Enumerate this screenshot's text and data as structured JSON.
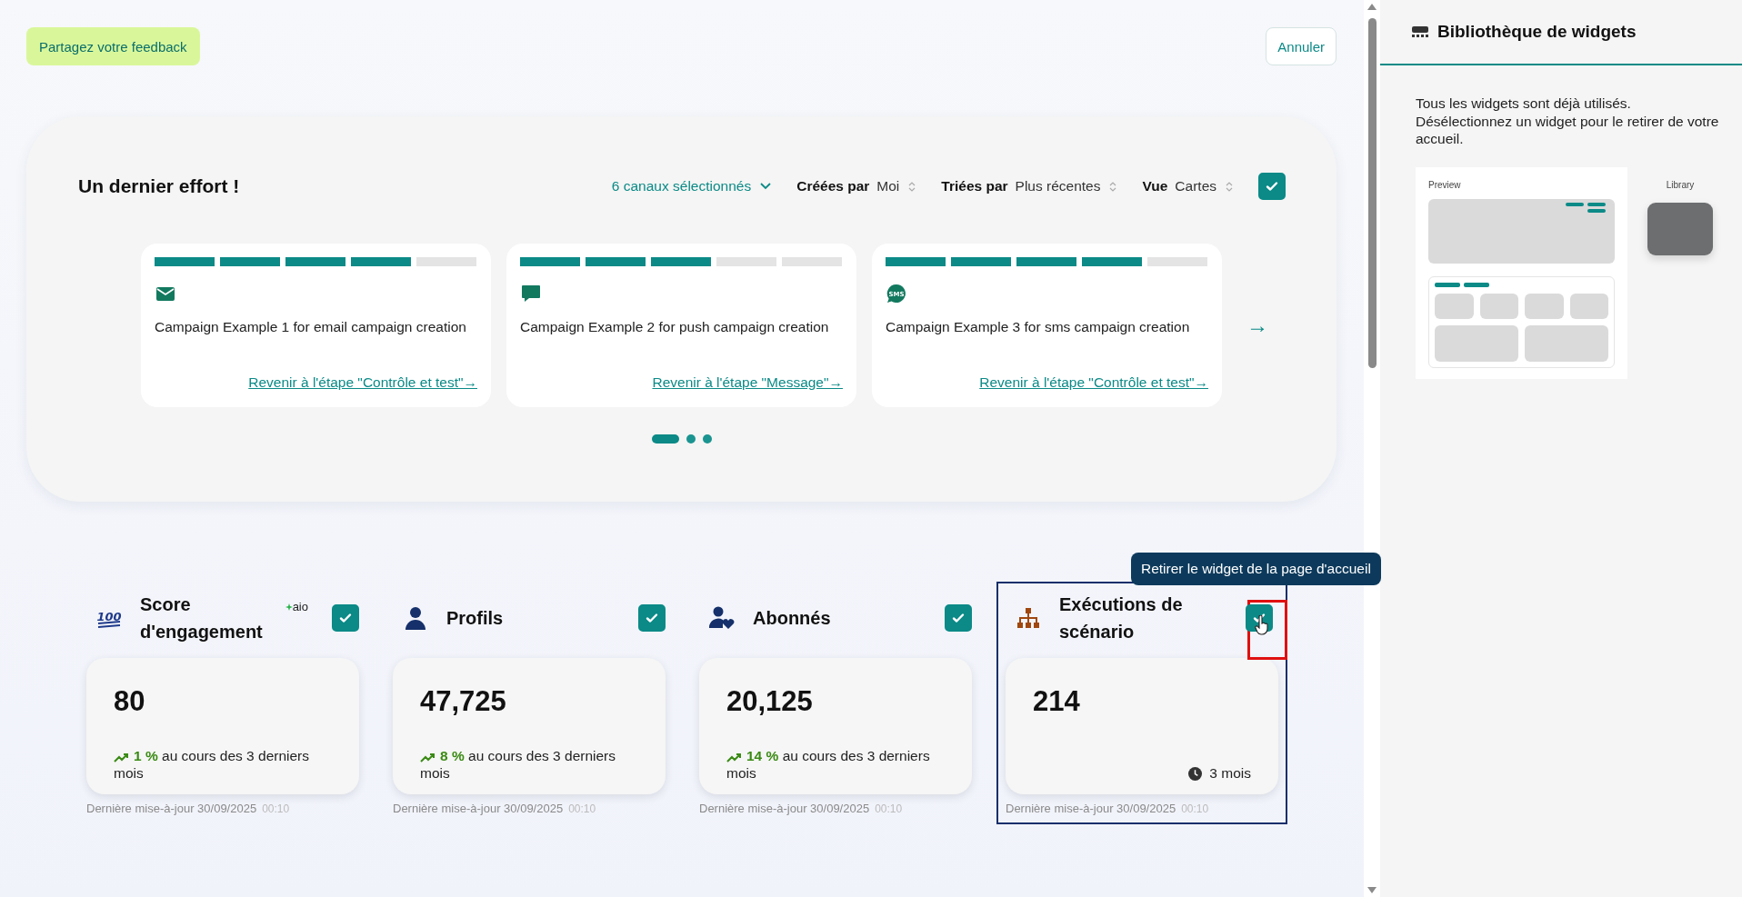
{
  "feedback_button": "Partagez votre feedback",
  "cancel_button": "Annuler",
  "carousel": {
    "title": "Un dernier effort !",
    "filters": [
      {
        "kind": "dropdown",
        "value": "6 canaux sélectionnés"
      },
      {
        "kind": "sort",
        "label": "Créées par",
        "value": "Moi"
      },
      {
        "kind": "sort",
        "label": "Triées par",
        "value": "Plus récentes"
      },
      {
        "kind": "sort",
        "label": "Vue",
        "value": "Cartes"
      }
    ],
    "checked": true,
    "campaigns": [
      {
        "kind": "email",
        "level": 0.8,
        "name": "Campaign Example 1 for email campaign creation",
        "link": "Revenir à l'étape \"Contrôle et test\"→"
      },
      {
        "kind": "push",
        "level": 0.6,
        "name": "Campaign Example 2 for push campaign creation",
        "link": "Revenir à l'étape \"Message\"→"
      },
      {
        "kind": "sms",
        "icon_text": "SMS",
        "level": 0.8,
        "name": "Campaign Example 3 for sms campaign creation",
        "link": "Revenir à l'étape \"Contrôle et test\"→"
      }
    ],
    "next_button": "→",
    "pages": [
      {
        "selected": true
      },
      {
        "selected": false
      },
      {
        "selected": false
      }
    ]
  },
  "widgets": [
    {
      "kind": "score",
      "icon_text": "100",
      "title": "Score d'engagement",
      "badge": "aio",
      "checked": true,
      "highlighted": false,
      "value": "80",
      "trend": "**1 %** au cours des 3 derniers mois",
      "updated": "Dernière mise-à-jour 30/09/2025",
      "time": "00:10"
    },
    {
      "kind": "profiles",
      "title": "Profils",
      "checked": true,
      "highlighted": false,
      "value": "47,725",
      "trend": "**8 %** au cours des 3 derniers mois",
      "updated": "Dernière mise-à-jour 30/09/2025",
      "time": "00:10"
    },
    {
      "kind": "subscribers",
      "title": "Abonnés",
      "checked": true,
      "highlighted": false,
      "value": "20,125",
      "trend": "**14 %** au cours des 3 derniers mois",
      "updated": "Dernière mise-à-jour 30/09/2025",
      "time": "00:10"
    },
    {
      "kind": "scenario",
      "title": "Exécutions de scénario",
      "checked": true,
      "highlighted": true,
      "value": "214",
      "period": "3 mois",
      "updated": "Dernière mise-à-jour 30/09/2025",
      "time": "00:10",
      "tooltip": "Retirer le widget de la page d'accueil"
    }
  ],
  "panel": {
    "title": "Bibliothèque de widgets",
    "description": [
      "Tous les widgets sont déjà utilisés.",
      "Désélectionnez un widget pour le retirer de votre accueil."
    ],
    "illustration": {
      "preview_label": "Preview",
      "library_label": "Library"
    }
  }
}
